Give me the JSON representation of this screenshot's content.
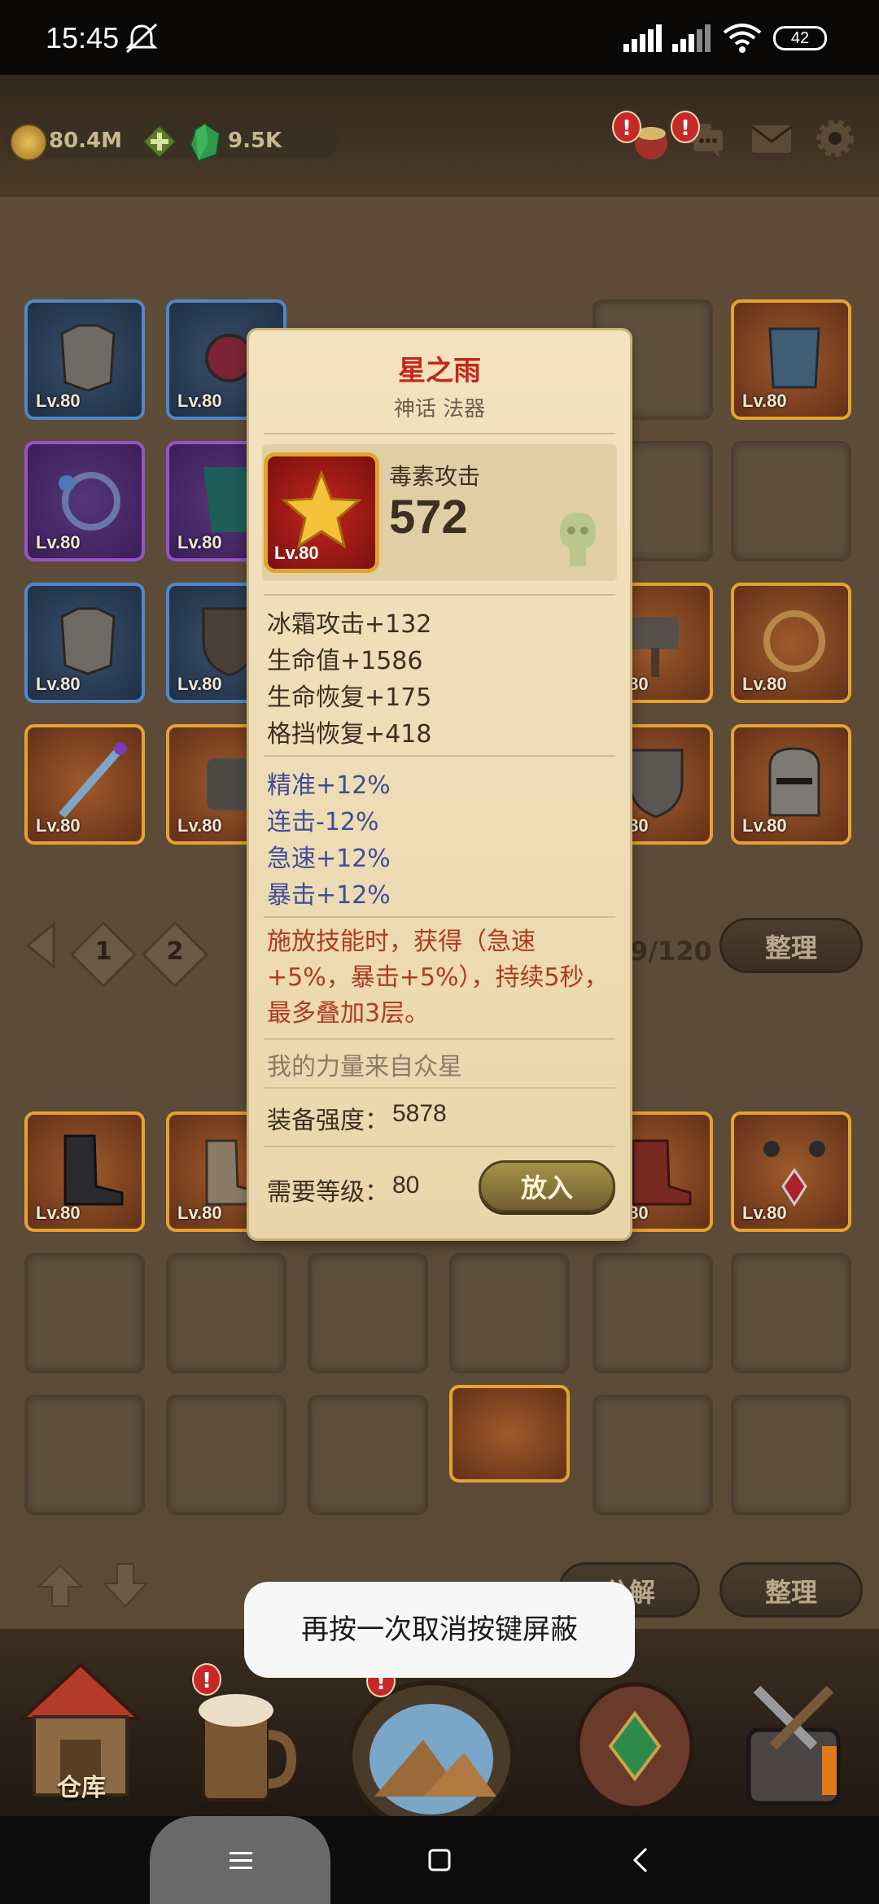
{
  "status_bar": {
    "time": "15:45",
    "battery": "42"
  },
  "resources": {
    "coins": "80.4M",
    "gems": "9.5K"
  },
  "slot_level": "Lv.80",
  "item": {
    "name": "星之雨",
    "type": "神话 法器",
    "main_stat_label": "毒素攻击",
    "main_stat_value": "572",
    "level": "Lv.80",
    "base_stats": [
      "冰霜攻击+132",
      "生命值+1586",
      "生命恢复+175",
      "格挡恢复+418"
    ],
    "secondary_stats": [
      "精准+12%",
      "连击-12%",
      "急速+12%",
      "暴击+12%"
    ],
    "skill_text": "施放技能时，获得（急速+5%，暴击+5%），持续5秒，最多叠加3层。",
    "flavor_text": "我的力量来自众星",
    "power_label": "装备强度：",
    "power_value": "5878",
    "req_label": "需要等级：",
    "req_value": "80",
    "equip_button": "放入"
  },
  "pager": {
    "pages": [
      "1",
      "2"
    ],
    "capacity": "9/120"
  },
  "buttons": {
    "sort_top": "整理",
    "decompose": "分解",
    "sort_bottom": "整理"
  },
  "toast": "再按一次取消按键屏蔽",
  "bottom_nav": {
    "warehouse": "仓库"
  }
}
